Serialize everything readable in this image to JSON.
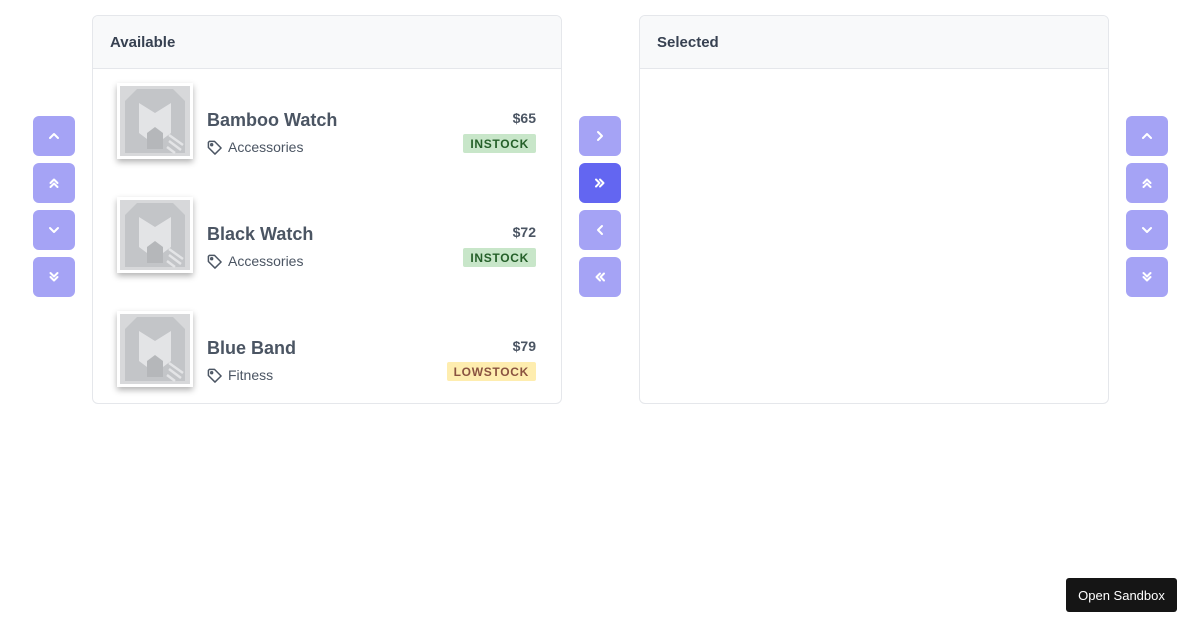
{
  "available": {
    "title": "Available",
    "items": [
      {
        "name": "Bamboo Watch",
        "category": "Accessories",
        "price": "$65",
        "status": "INSTOCK",
        "status_key": "instock"
      },
      {
        "name": "Black Watch",
        "category": "Accessories",
        "price": "$72",
        "status": "INSTOCK",
        "status_key": "instock"
      },
      {
        "name": "Blue Band",
        "category": "Fitness",
        "price": "$79",
        "status": "LOWSTOCK",
        "status_key": "lowstock"
      }
    ]
  },
  "selected": {
    "title": "Selected",
    "items": []
  },
  "controls": {
    "source_reorder": [
      "chevron-up-icon",
      "chevrons-up-icon",
      "chevron-down-icon",
      "chevrons-down-icon"
    ],
    "transfer": [
      "chevron-right-icon",
      "chevrons-right-icon",
      "chevron-left-icon",
      "chevrons-left-icon"
    ],
    "target_reorder": [
      "chevron-up-icon",
      "chevrons-up-icon",
      "chevron-down-icon",
      "chevrons-down-icon"
    ]
  },
  "sandbox_label": "Open Sandbox",
  "colors": {
    "button": "#a5a3f5",
    "button_active": "#6366f1",
    "instock_bg": "#c8e6c9",
    "instock_text": "#256029",
    "lowstock_bg": "#feedaf",
    "lowstock_text": "#8a5340"
  }
}
